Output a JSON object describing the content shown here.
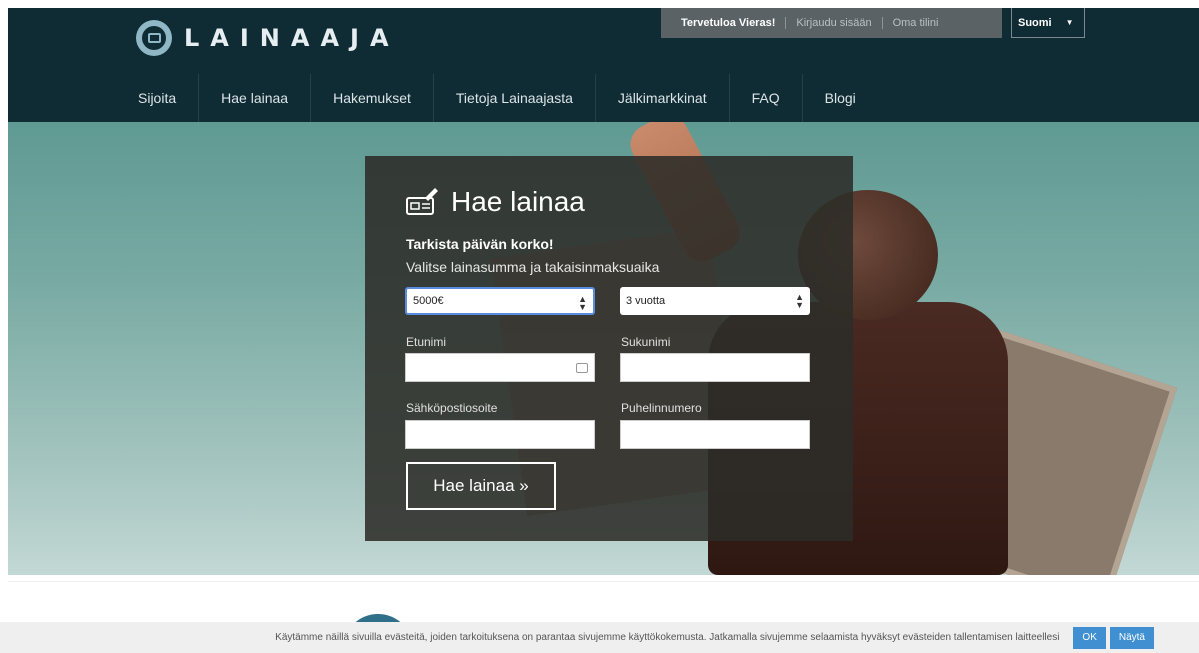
{
  "header": {
    "brand": "LAINAAJA",
    "welcome": "Tervetuloa Vieras!",
    "login_link": "Kirjaudu sisään",
    "account_link": "Oma tilini",
    "language": "Suomi",
    "nav": [
      "Sijoita",
      "Hae lainaa",
      "Hakemukset",
      "Tietoja Lainaajasta",
      "Jälkimarkkinat",
      "FAQ",
      "Blogi"
    ]
  },
  "form": {
    "title": "Hae lainaa",
    "subtitle": "Tarkista päivän korko!",
    "instruction": "Valitse lainasumma ja takaisinmaksuaika",
    "amount_value": "5000€",
    "term_value": "3 vuotta",
    "first_name_label": "Etunimi",
    "last_name_label": "Sukunimi",
    "email_label": "Sähköpostiosoite",
    "phone_label": "Puhelinnumero",
    "submit_label": "Hae lainaa »"
  },
  "cookie": {
    "text": "Käytämme näillä sivuilla evästeitä, joiden tarkoituksena on parantaa sivujemme käyttökokemusta. Jatkamalla sivujemme selaamista hyväksyt evästeiden tallentamisen laitteellesi",
    "ok_label": "OK",
    "show_label": "Näytä"
  },
  "colors": {
    "header_bg": "#0f2b33",
    "accent": "#3f8fd1"
  }
}
